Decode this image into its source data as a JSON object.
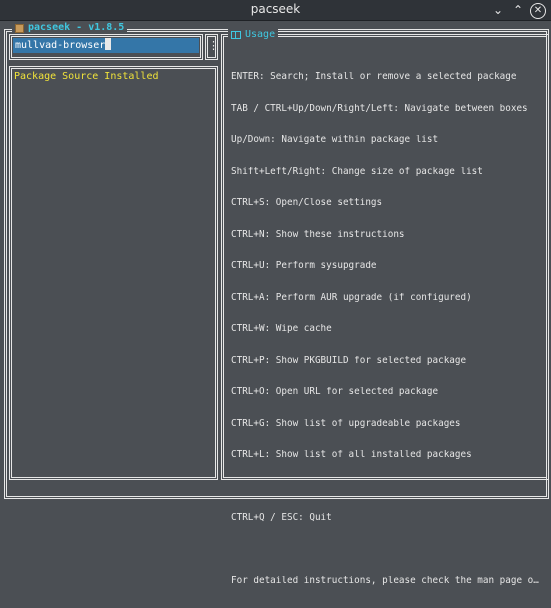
{
  "window": {
    "title": "pacseek"
  },
  "app": {
    "title": "pacseek - v1.8.5"
  },
  "search": {
    "value": "mullvad-browser"
  },
  "menu": {
    "glyph": "⋮"
  },
  "list": {
    "header": "Package Source Installed"
  },
  "usage": {
    "title": "Usage",
    "lines": [
      "ENTER: Search; Install or remove a selected package",
      "TAB / CTRL+Up/Down/Right/Left: Navigate between boxes",
      "Up/Down: Navigate within package list",
      "Shift+Left/Right: Change size of package list",
      "CTRL+S: Open/Close settings",
      "CTRL+N: Show these instructions",
      "CTRL+U: Perform sysupgrade",
      "CTRL+A: Perform AUR upgrade (if configured)",
      "CTRL+W: Wipe cache",
      "CTRL+P: Show PKGBUILD for selected package",
      "CTRL+O: Open URL for selected package",
      "CTRL+G: Show list of upgradeable packages",
      "CTRL+L: Show list of all installed packages",
      "",
      "CTRL+Q / ESC: Quit",
      "",
      "For detailed instructions, please check the man page or …"
    ]
  },
  "colors": {
    "accent": "#3fc7e0",
    "header": "#f0e33a",
    "input_bg": "#3476a8",
    "background": "#4b4f54"
  }
}
